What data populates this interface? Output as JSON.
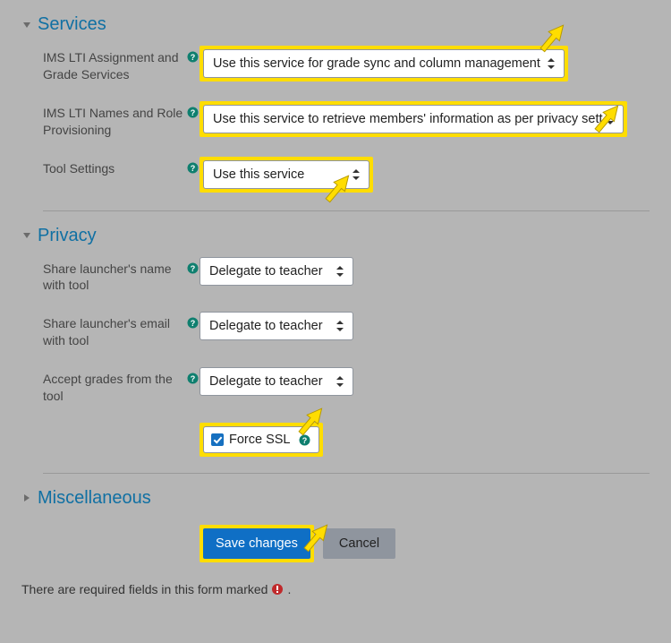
{
  "sections": {
    "services": {
      "title": "Services"
    },
    "privacy": {
      "title": "Privacy"
    },
    "misc": {
      "title": "Miscellaneous"
    }
  },
  "services": {
    "grade": {
      "label": "IMS LTI Assignment and Grade Services",
      "value": "Use this service for grade sync and column management"
    },
    "names": {
      "label": "IMS LTI Names and Role Provisioning",
      "value": "Use this service to retrieve members' information as per privacy sett"
    },
    "tool": {
      "label": "Tool Settings",
      "value": "Use this service"
    }
  },
  "privacy": {
    "share_name": {
      "label": "Share launcher's name with tool",
      "value": "Delegate to teacher"
    },
    "share_email": {
      "label": "Share launcher's email with tool",
      "value": "Delegate to teacher"
    },
    "accept_grades": {
      "label": "Accept grades from the tool",
      "value": "Delegate to teacher"
    },
    "force_ssl": {
      "label": "Force SSL"
    }
  },
  "buttons": {
    "save": "Save changes",
    "cancel": "Cancel"
  },
  "footer": {
    "text": "There are required fields in this form marked",
    "suffix": "."
  }
}
